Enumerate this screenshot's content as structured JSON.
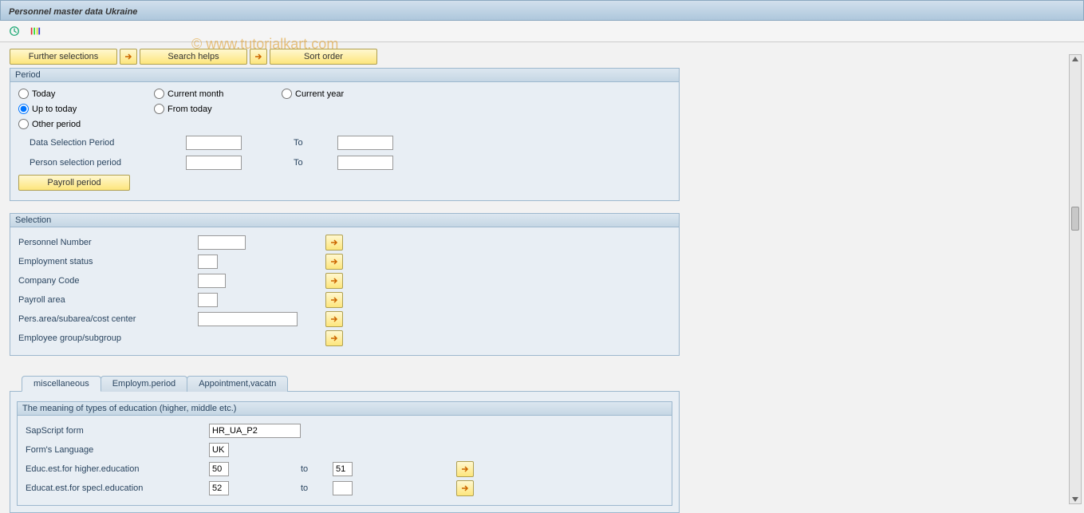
{
  "header": {
    "title": "Personnel master data Ukraine"
  },
  "watermark": "© www.tutorialkart.com",
  "buttons": {
    "further_selections": "Further selections",
    "search_helps": "Search helps",
    "sort_order": "Sort order",
    "payroll_period": "Payroll period"
  },
  "period": {
    "title": "Period",
    "today": "Today",
    "current_month": "Current month",
    "current_year": "Current year",
    "up_to_today": "Up to today",
    "from_today": "From today",
    "other_period": "Other period",
    "data_selection": "Data Selection Period",
    "person_selection": "Person selection period",
    "to": "To"
  },
  "selection": {
    "title": "Selection",
    "personnel_number": "Personnel Number",
    "employment_status": "Employment status",
    "company_code": "Company Code",
    "payroll_area": "Payroll area",
    "pers_area": "Pers.area/subarea/cost center",
    "employee_group": "Employee group/subgroup"
  },
  "tabs": {
    "misc": "miscellaneous",
    "employ": "Employm.period",
    "appoint": "Appointment,vacatn"
  },
  "education": {
    "title": "The meaning of types of education (higher, middle etc.)",
    "sapscript": "SapScript form",
    "sapscript_val": "HR_UA_P2",
    "lang": "Form's Language",
    "lang_val": "UK",
    "higher": "Educ.est.for higher.education",
    "higher_from": "50",
    "higher_to": "51",
    "special": "Educat.est.for specl.education",
    "special_from": "52",
    "special_to": "",
    "to": "to"
  }
}
